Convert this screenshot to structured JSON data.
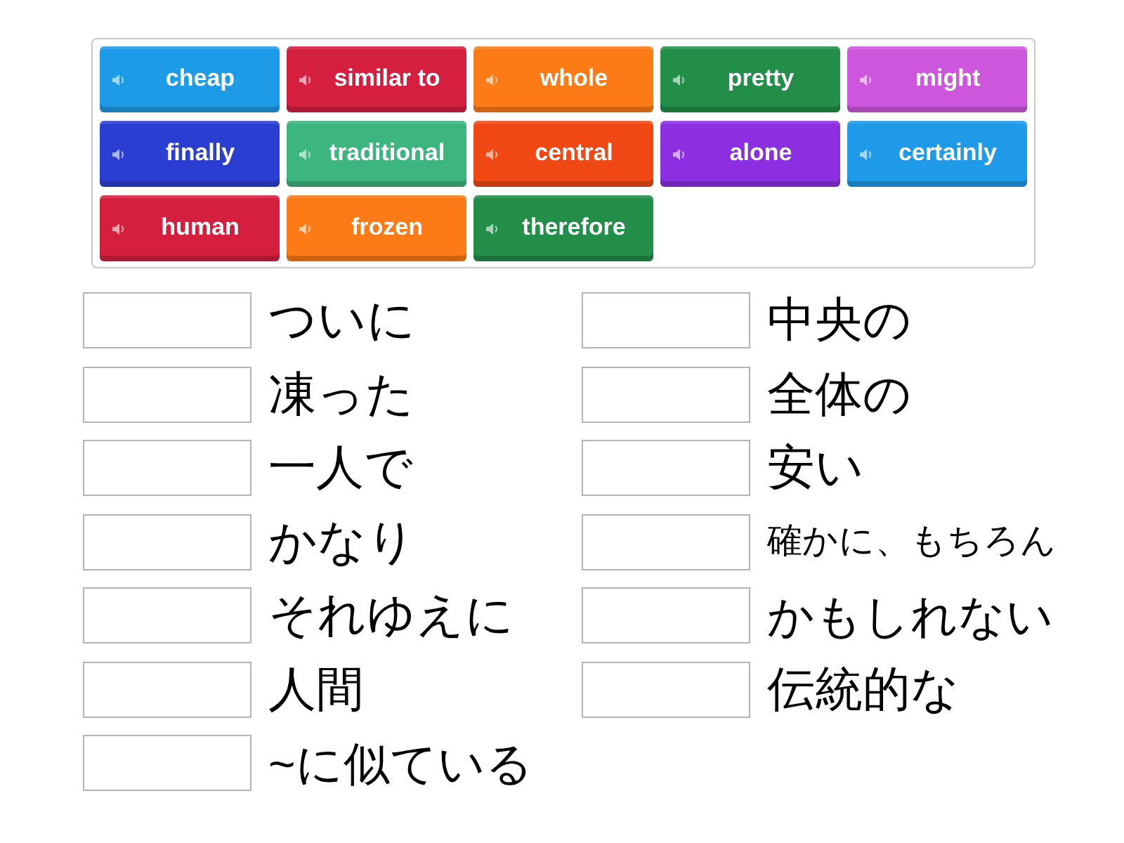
{
  "tiles": [
    {
      "label": "cheap",
      "color": "#1e9be6"
    },
    {
      "label": "similar to",
      "color": "#d51f3f"
    },
    {
      "label": "whole",
      "color": "#fd7b16"
    },
    {
      "label": "pretty",
      "color": "#228e48"
    },
    {
      "label": "might",
      "color": "#cc57dc"
    },
    {
      "label": "finally",
      "color": "#2a3fd1"
    },
    {
      "label": "traditional",
      "color": "#3db57f"
    },
    {
      "label": "central",
      "color": "#f04815"
    },
    {
      "label": "alone",
      "color": "#8b2fe0"
    },
    {
      "label": "certainly",
      "color": "#1f9ae8"
    },
    {
      "label": "human",
      "color": "#d51f3f"
    },
    {
      "label": "frozen",
      "color": "#fd7b16"
    },
    {
      "label": "therefore",
      "color": "#228e48"
    }
  ],
  "clue_columns": [
    {
      "clues": [
        {
          "text": "ついに"
        },
        {
          "text": "凍った"
        },
        {
          "text": "一人で"
        },
        {
          "text": "かなり"
        },
        {
          "text": "それゆえに"
        },
        {
          "text": "人間"
        },
        {
          "text": "~に似ている"
        }
      ]
    },
    {
      "clues": [
        {
          "text": "中央の"
        },
        {
          "text": "全体の"
        },
        {
          "text": "安い"
        },
        {
          "text": "確かに、もちろん"
        },
        {
          "text": "かもしれない"
        },
        {
          "text": "伝統的な"
        }
      ]
    }
  ]
}
